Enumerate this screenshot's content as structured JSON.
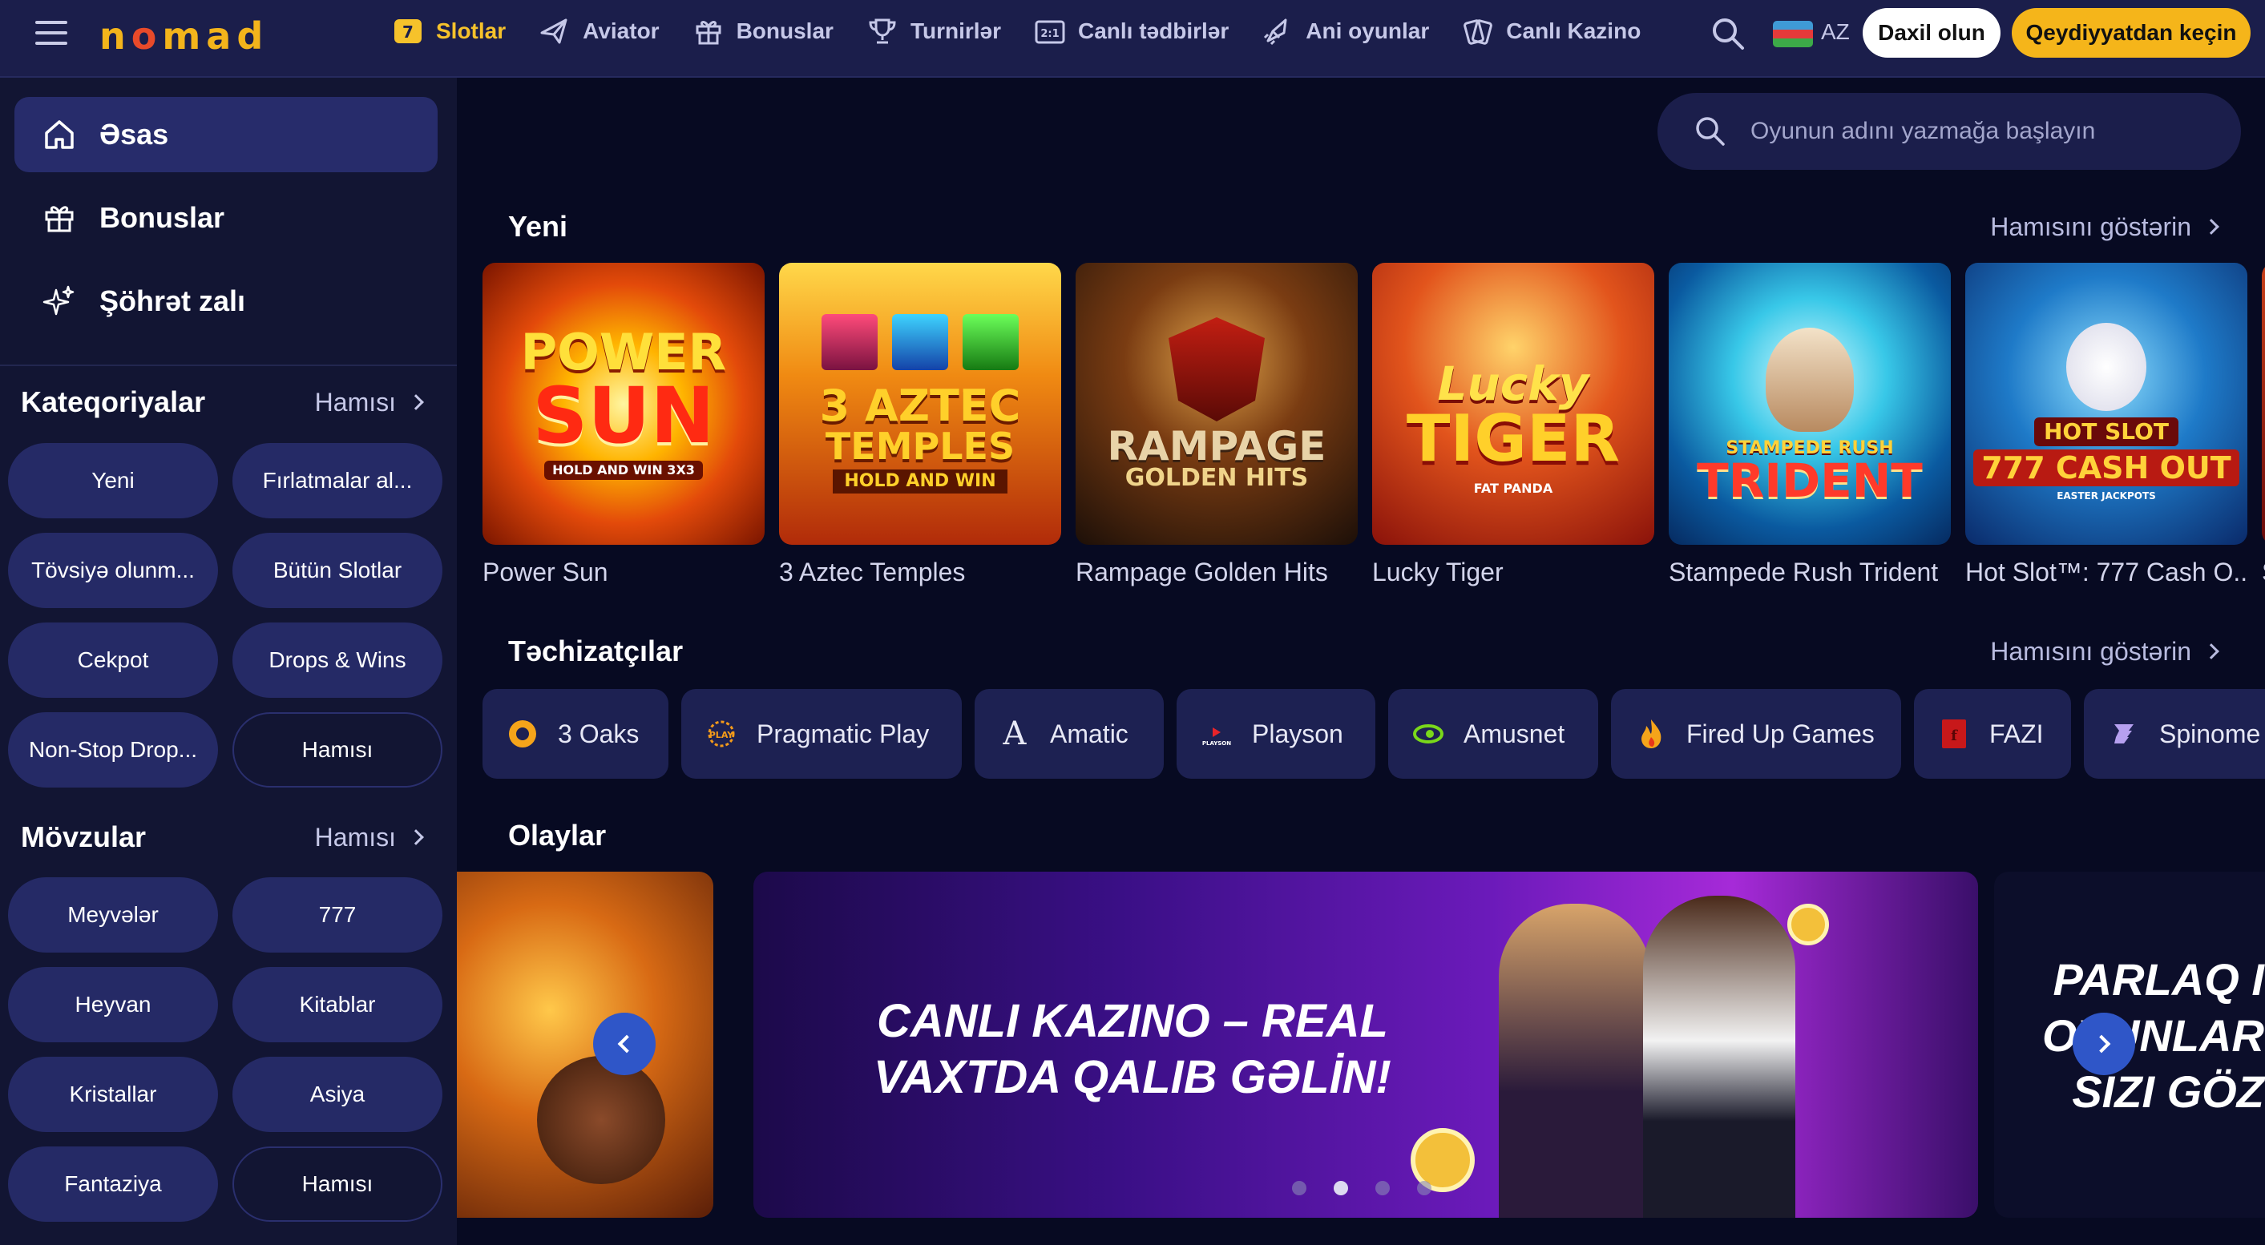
{
  "header": {
    "logo": "NOMAD",
    "nav": [
      {
        "label": "Slotlar",
        "icon": "slot-seven-icon",
        "active": true
      },
      {
        "label": "Aviator",
        "icon": "plane-icon"
      },
      {
        "label": "Bonuslar",
        "icon": "gift-icon"
      },
      {
        "label": "Turnirlər",
        "icon": "trophy-icon"
      },
      {
        "label": "Canlı tədbirlər",
        "icon": "scoreboard-icon"
      },
      {
        "label": "Ani oyunlar",
        "icon": "rocket-icon"
      },
      {
        "label": "Canlı Kazino",
        "icon": "cards-icon"
      }
    ],
    "lang": "AZ",
    "login": "Daxil olun",
    "register": "Qeydiyyatdan keçin"
  },
  "sidebar": {
    "menu": [
      {
        "label": "Əsas",
        "icon": "home-icon",
        "active": true
      },
      {
        "label": "Bonuslar",
        "icon": "gift-icon"
      },
      {
        "label": "Şöhrət zalı",
        "icon": "sparkle-icon"
      }
    ],
    "categories": {
      "title": "Kateqoriyalar",
      "all": "Hamısı",
      "items": [
        "Yeni",
        "Fırlatmalar al...",
        "Tövsiyə olunm...",
        "Bütün Slotlar",
        "Cekpot",
        "Drops & Wins",
        "Non-Stop Drop...",
        "Hamısı"
      ]
    },
    "themes": {
      "title": "Mövzular",
      "all": "Hamısı",
      "items": [
        "Meyvələr",
        "777",
        "Heyvan",
        "Kitablar",
        "Kristallar",
        "Asiya",
        "Fantaziya",
        "Hamısı"
      ]
    }
  },
  "search": {
    "placeholder": "Oyunun adını yazmağa başlayın"
  },
  "new_games": {
    "title": "Yeni",
    "all": "Hamısını göstərin",
    "items": [
      {
        "name": "Power Sun",
        "art": [
          "POWER",
          "SUN",
          "HOLD AND WIN 3X3"
        ]
      },
      {
        "name": "3 Aztec Temples",
        "art": [
          "3 AZTEC",
          "TEMPLES",
          "HOLD AND WIN"
        ]
      },
      {
        "name": "Rampage Golden Hits",
        "art": [
          "RAMPAGE",
          "GOLDEN HITS"
        ]
      },
      {
        "name": "Lucky Tiger",
        "art": [
          "Lucky",
          "TIGER",
          "FAT PANDA"
        ]
      },
      {
        "name": "Stampede Rush Trident",
        "art": [
          "STAMPEDE RUSH",
          "TRIDENT"
        ]
      },
      {
        "name": "Hot Slot™: 777 Cash O...",
        "art": [
          "HOT SLOT",
          "777 CASH OUT",
          "EASTER JACKPOTS"
        ]
      },
      {
        "name": "S",
        "art": []
      }
    ]
  },
  "providers": {
    "title": "Təchizatçılar",
    "all": "Hamısını göstərin",
    "items": [
      {
        "name": "3 Oaks",
        "icon": "oak-shield-icon"
      },
      {
        "name": "Pragmatic Play",
        "icon": "pragmatic-icon"
      },
      {
        "name": "Amatic",
        "icon": "amatic-a-icon"
      },
      {
        "name": "Playson",
        "icon": "playson-icon"
      },
      {
        "name": "Amusnet",
        "icon": "amusnet-eye-icon"
      },
      {
        "name": "Fired Up Games",
        "icon": "flame-icon"
      },
      {
        "name": "FAZI",
        "icon": "fazi-icon"
      },
      {
        "name": "Spinome",
        "icon": "spinomenal-icon"
      }
    ]
  },
  "events": {
    "title": "Olaylar",
    "main_banner": [
      "CANLI KAZINO – REAL",
      "VAXTDA QALIB GƏLİN!"
    ],
    "right_banner": [
      "PARLAQ I",
      "OYUNLAR",
      "SIZI GÖZ"
    ],
    "slide_count": 4,
    "active_slide": 1
  },
  "colors": {
    "accent": "#f5b51a",
    "header_bg": "#1b1e4b",
    "pill_bg": "#252a66",
    "page_bg": "#070a22"
  }
}
